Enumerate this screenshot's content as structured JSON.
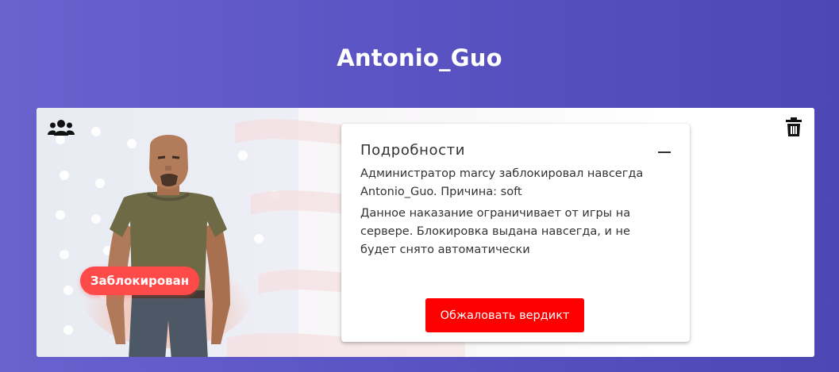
{
  "header": {
    "title": "Antonio_Guo"
  },
  "card": {
    "status_badge": "Заблокирован",
    "details": {
      "title": "Подробности",
      "paragraph_1": "Администратор marcy заблокировал навсегда Antonio_Guo. Причина: soft",
      "paragraph_2": "Данное наказание ограничивает от игры на сервере. Блокировка выдана навсегда, и не будет снято автоматически",
      "appeal_button": "Обжаловать вердикт"
    }
  },
  "icons": {
    "top_left": "users-group-icon",
    "top_right": "trash-icon",
    "collapse": "minus-icon"
  },
  "colors": {
    "background": "#5a54c4",
    "badge": "#ff4a4a",
    "appeal_button": "#ff0000",
    "card": "#ffffff"
  }
}
